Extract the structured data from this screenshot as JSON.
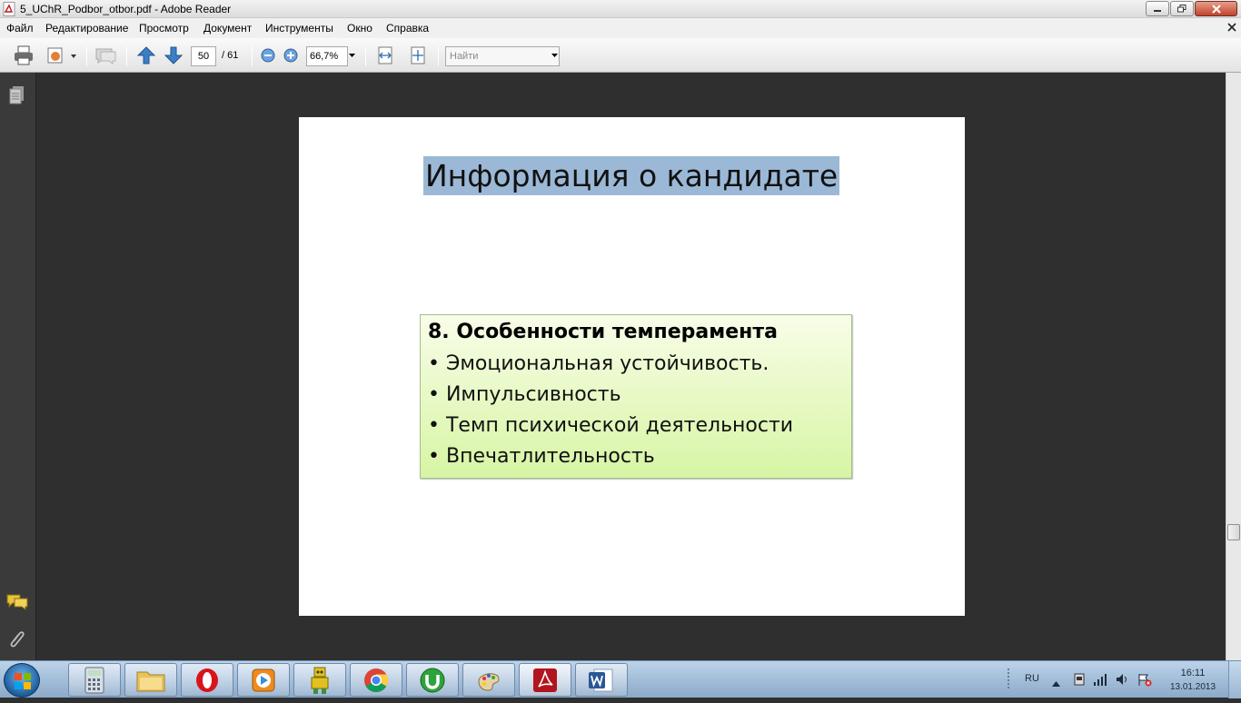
{
  "window": {
    "title": "5_UChR_Podbor_otbor.pdf - Adobe Reader"
  },
  "menu": {
    "items": [
      "Файл",
      "Редактирование",
      "Просмотр",
      "Документ",
      "Инструменты",
      "Окно",
      "Справка"
    ]
  },
  "toolbar": {
    "page_current": "50",
    "page_total": "/ 61",
    "zoom": "66,7%",
    "search_placeholder": "Найти"
  },
  "slide": {
    "title": "Информация о кандидате",
    "box_heading": "8. Особенности темперамента",
    "bullets": [
      "• Эмоциональная устойчивость.",
      "• Импульсивность",
      "• Темп психической деятельности",
      "• Впечатлительность"
    ]
  },
  "taskbar": {
    "apps": [
      "calculator",
      "file-explorer",
      "opera",
      "media-player",
      "game",
      "chrome",
      "utorrent",
      "paint",
      "adobe-reader",
      "word"
    ]
  },
  "tray": {
    "language": "RU",
    "time": "16:11",
    "date": "13.01.2013"
  },
  "colors": {
    "title_highlight": "#9bb9d6",
    "box_top": "#f8fde8",
    "box_bottom": "#d7f5a4",
    "workspace": "#2f2f2f"
  }
}
